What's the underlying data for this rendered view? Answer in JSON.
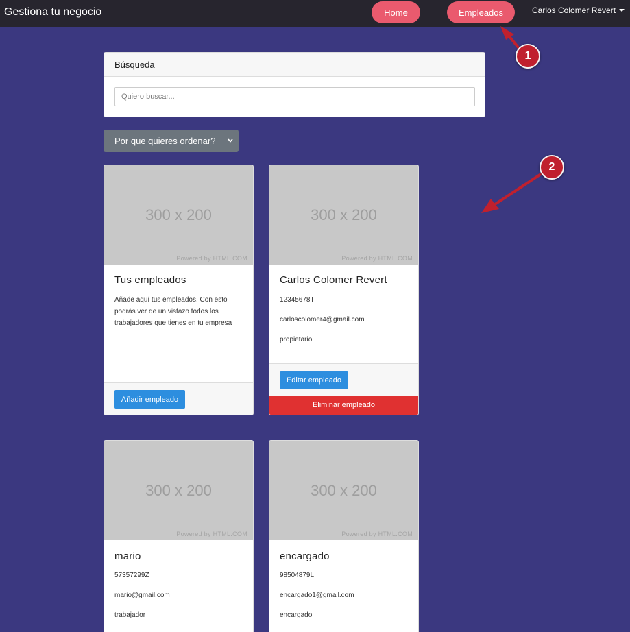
{
  "navbar": {
    "brand": "Gestiona tu negocio",
    "home_label": "Home",
    "employees_label": "Empleados",
    "user_label": "Carlos Colomer Revert"
  },
  "search": {
    "header": "Búsqueda",
    "placeholder": "Quiero buscar..."
  },
  "sort": {
    "label": "Por que quieres ordenar?"
  },
  "placeholder_image": {
    "dims": "300 x 200",
    "powered": "Powered by HTML.COM"
  },
  "cards": [
    {
      "title": "Tus empleados",
      "text": "Añade aquí tus empleados. Con esto podrás ver de un vistazo todos los trabajadores que tienes en tu empresa",
      "button": "Añadir empleado"
    },
    {
      "title": "Carlos Colomer Revert",
      "id": "12345678T",
      "email": "carloscolomer4@gmail.com",
      "role": "propietario",
      "edit_button": "Editar empleado",
      "delete_button": "Eliminar empleado"
    },
    {
      "title": "mario",
      "id": "57357299Z",
      "email": "mario@gmail.com",
      "role": "trabajador"
    },
    {
      "title": "encargado",
      "id": "98504879L",
      "email": "encargado1@gmail.com",
      "role": "encargado"
    }
  ],
  "annotations": {
    "badge1": "1",
    "badge2": "2",
    "color": "#c0202e"
  },
  "colors": {
    "background": "#3b3880",
    "navbar": "#27252e",
    "nav_pill": "#ea5a6e",
    "primary_button": "#2d8edf",
    "danger_button": "#e03131",
    "secondary_button": "#6c757d"
  }
}
